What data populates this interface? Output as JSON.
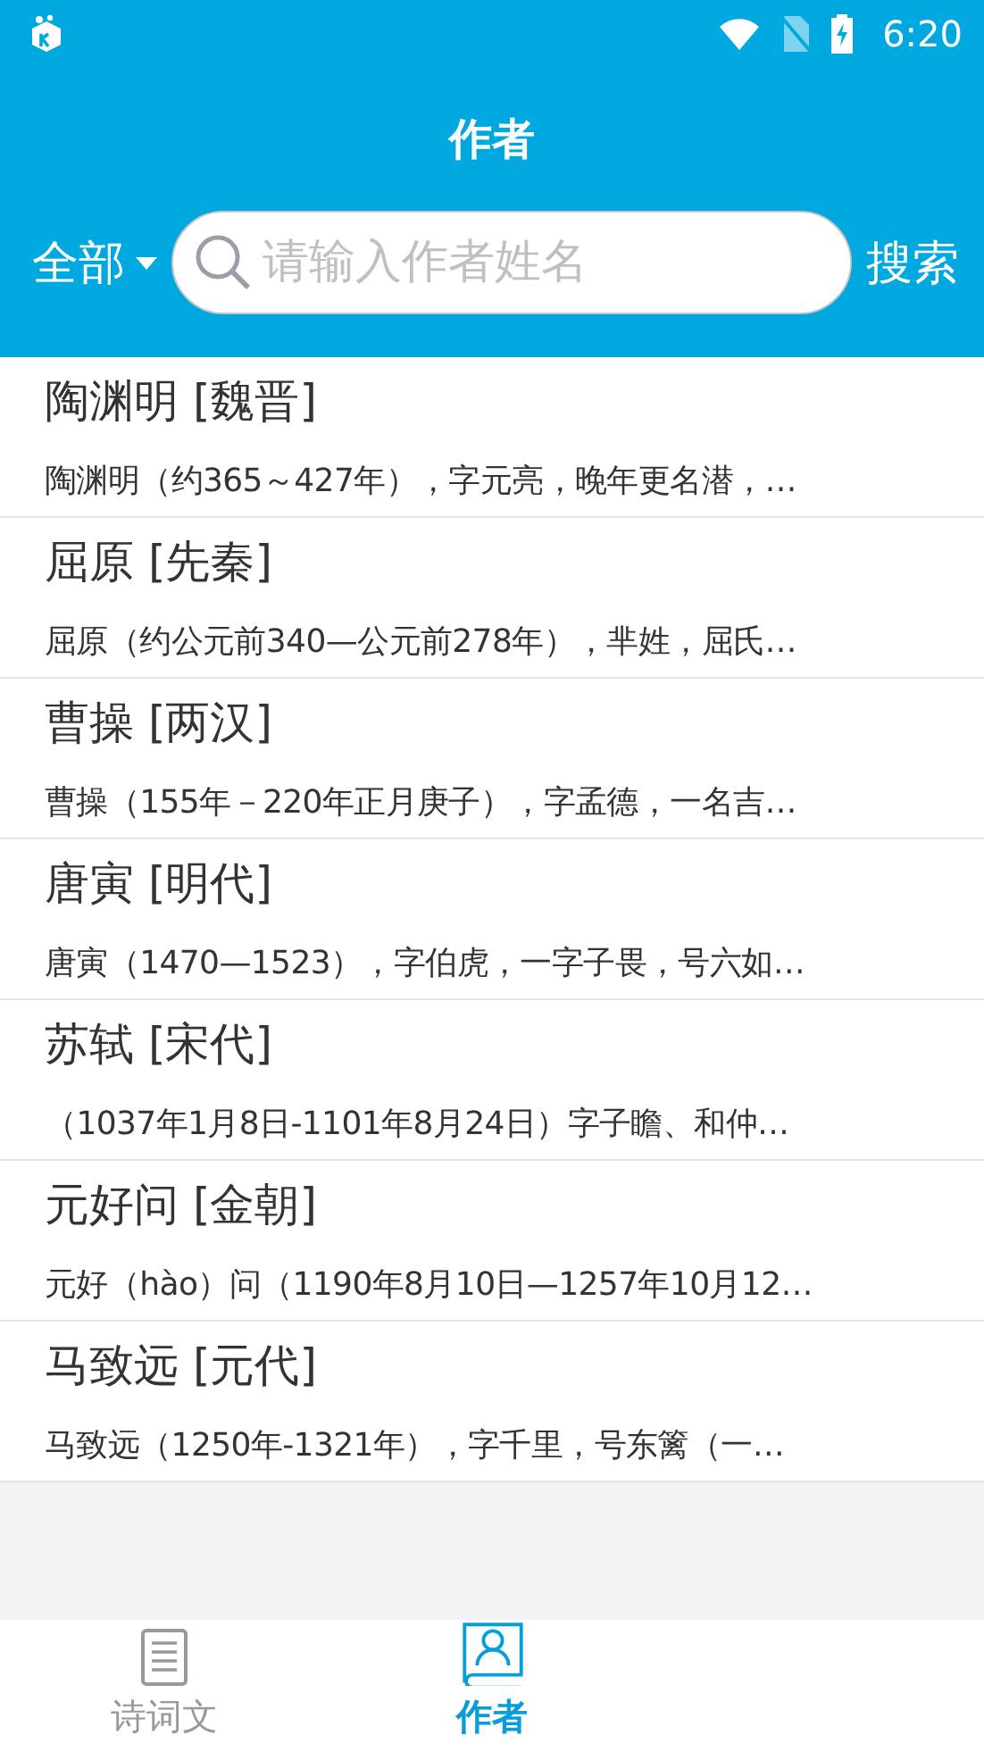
{
  "status_bar": {
    "time": "6:20"
  },
  "header": {
    "title": "作者",
    "filter": {
      "label": "全部"
    },
    "search": {
      "placeholder": "请输入作者姓名"
    },
    "search_button": "搜索"
  },
  "authors": [
    {
      "name": "陶渊明 [魏晋]",
      "summary": "陶渊明（约365～427年），字元亮，晚年更名潜，…"
    },
    {
      "name": "屈原 [先秦]",
      "summary": "屈原（约公元前340—公元前278年），芈姓，屈氏…"
    },
    {
      "name": "曹操 [两汉]",
      "summary": "曹操（155年－220年正月庚子），字孟德，一名吉…"
    },
    {
      "name": "唐寅 [明代]",
      "summary": "唐寅（1470—1523），字伯虎，一字子畏，号六如…"
    },
    {
      "name": "苏轼 [宋代]",
      "summary": "（1037年1月8日-1101年8月24日）字子瞻、和仲…"
    },
    {
      "name": "元好问 [金朝]",
      "summary": "元好（hào）问（1190年8月10日—1257年10月12…"
    },
    {
      "name": "马致远 [元代]",
      "summary": "马致远（1250年-1321年），字千里，号东篱（一…"
    }
  ],
  "tabs": [
    {
      "label": "诗词文",
      "kind": "document",
      "selected": false
    },
    {
      "label": "作者",
      "kind": "person",
      "selected": true
    }
  ]
}
